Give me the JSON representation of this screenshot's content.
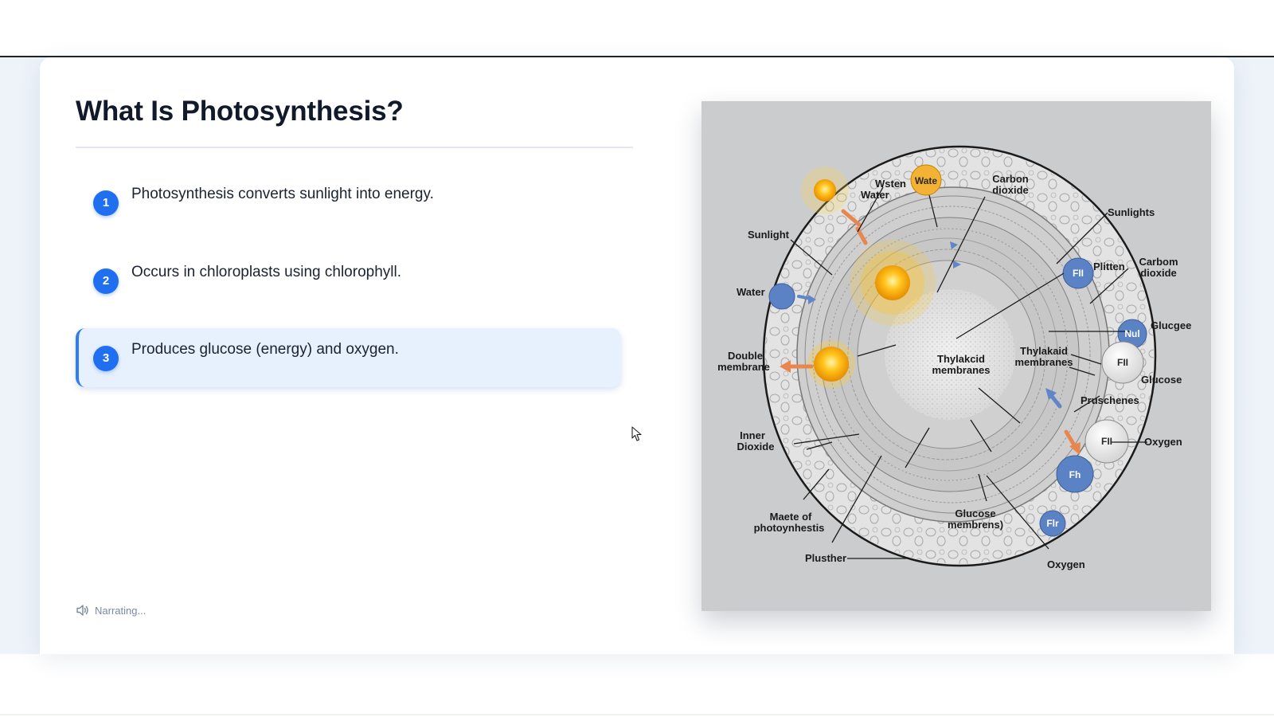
{
  "slide": {
    "title": "What Is Photosynthesis?",
    "bullets": [
      {
        "number": "1",
        "text": "Photosynthesis converts sunlight into energy.",
        "active": false
      },
      {
        "number": "2",
        "text": "Occurs in chloroplasts using chlorophyll.",
        "active": false
      },
      {
        "number": "3",
        "text": "Produces glucose (energy) and oxygen.",
        "active": true
      }
    ],
    "narration_status": "Narrating...",
    "narration_icon": "speaker-icon"
  },
  "figure": {
    "labels": {
      "sunlight_left": "Sunlight",
      "water_top_1": "Wsten",
      "water_top_2": "Water",
      "water_node": "Wate",
      "carbon_top_1": "Carbon",
      "carbon_top_2": "dioxide",
      "sunlights": "Sunlights",
      "plitten": "Plitten",
      "carbon_right_1": "Carbom",
      "carbon_right_2": "dioxide",
      "water_left": "Water",
      "glucgee": "Glucgee",
      "double_1": "Double",
      "double_2": "membrane",
      "thylakoid_center_1": "Thylakcid",
      "thylakoid_center_2": "membranes",
      "thylakoid_right_1": "Thylakaid",
      "thylakoid_right_2": "membranes",
      "glucose_right": "Glucose",
      "pruschenes": "Pruschenes",
      "inner_1": "Inner",
      "inner_2": "Dioxide",
      "oxygen_right": "Oxygen",
      "maete_1": "Maete of",
      "maete_2": "photoynhestis",
      "glucose_bottom_1": "Glucose",
      "glucose_bottom_2": "membrens)",
      "plusther": "Plusther",
      "oxygen_bottom": "Oxygen",
      "node_fii_1": "FII",
      "node_nul": "Nul",
      "node_fii_2": "FII",
      "node_fii_3": "FII",
      "node_fh": "Fh",
      "node_flr": "Flr"
    },
    "colors": {
      "background": "#cbcccd",
      "blue_node": "#5b82c4",
      "sun": "#f4b400",
      "orange_arrow": "#e8864e",
      "blue_arrow": "#5f86c6"
    }
  },
  "colors": {
    "accent": "#1f6ff0",
    "active_row": "#e7f0fd",
    "title": "#111a2b",
    "narration": "#7a8aa0"
  }
}
